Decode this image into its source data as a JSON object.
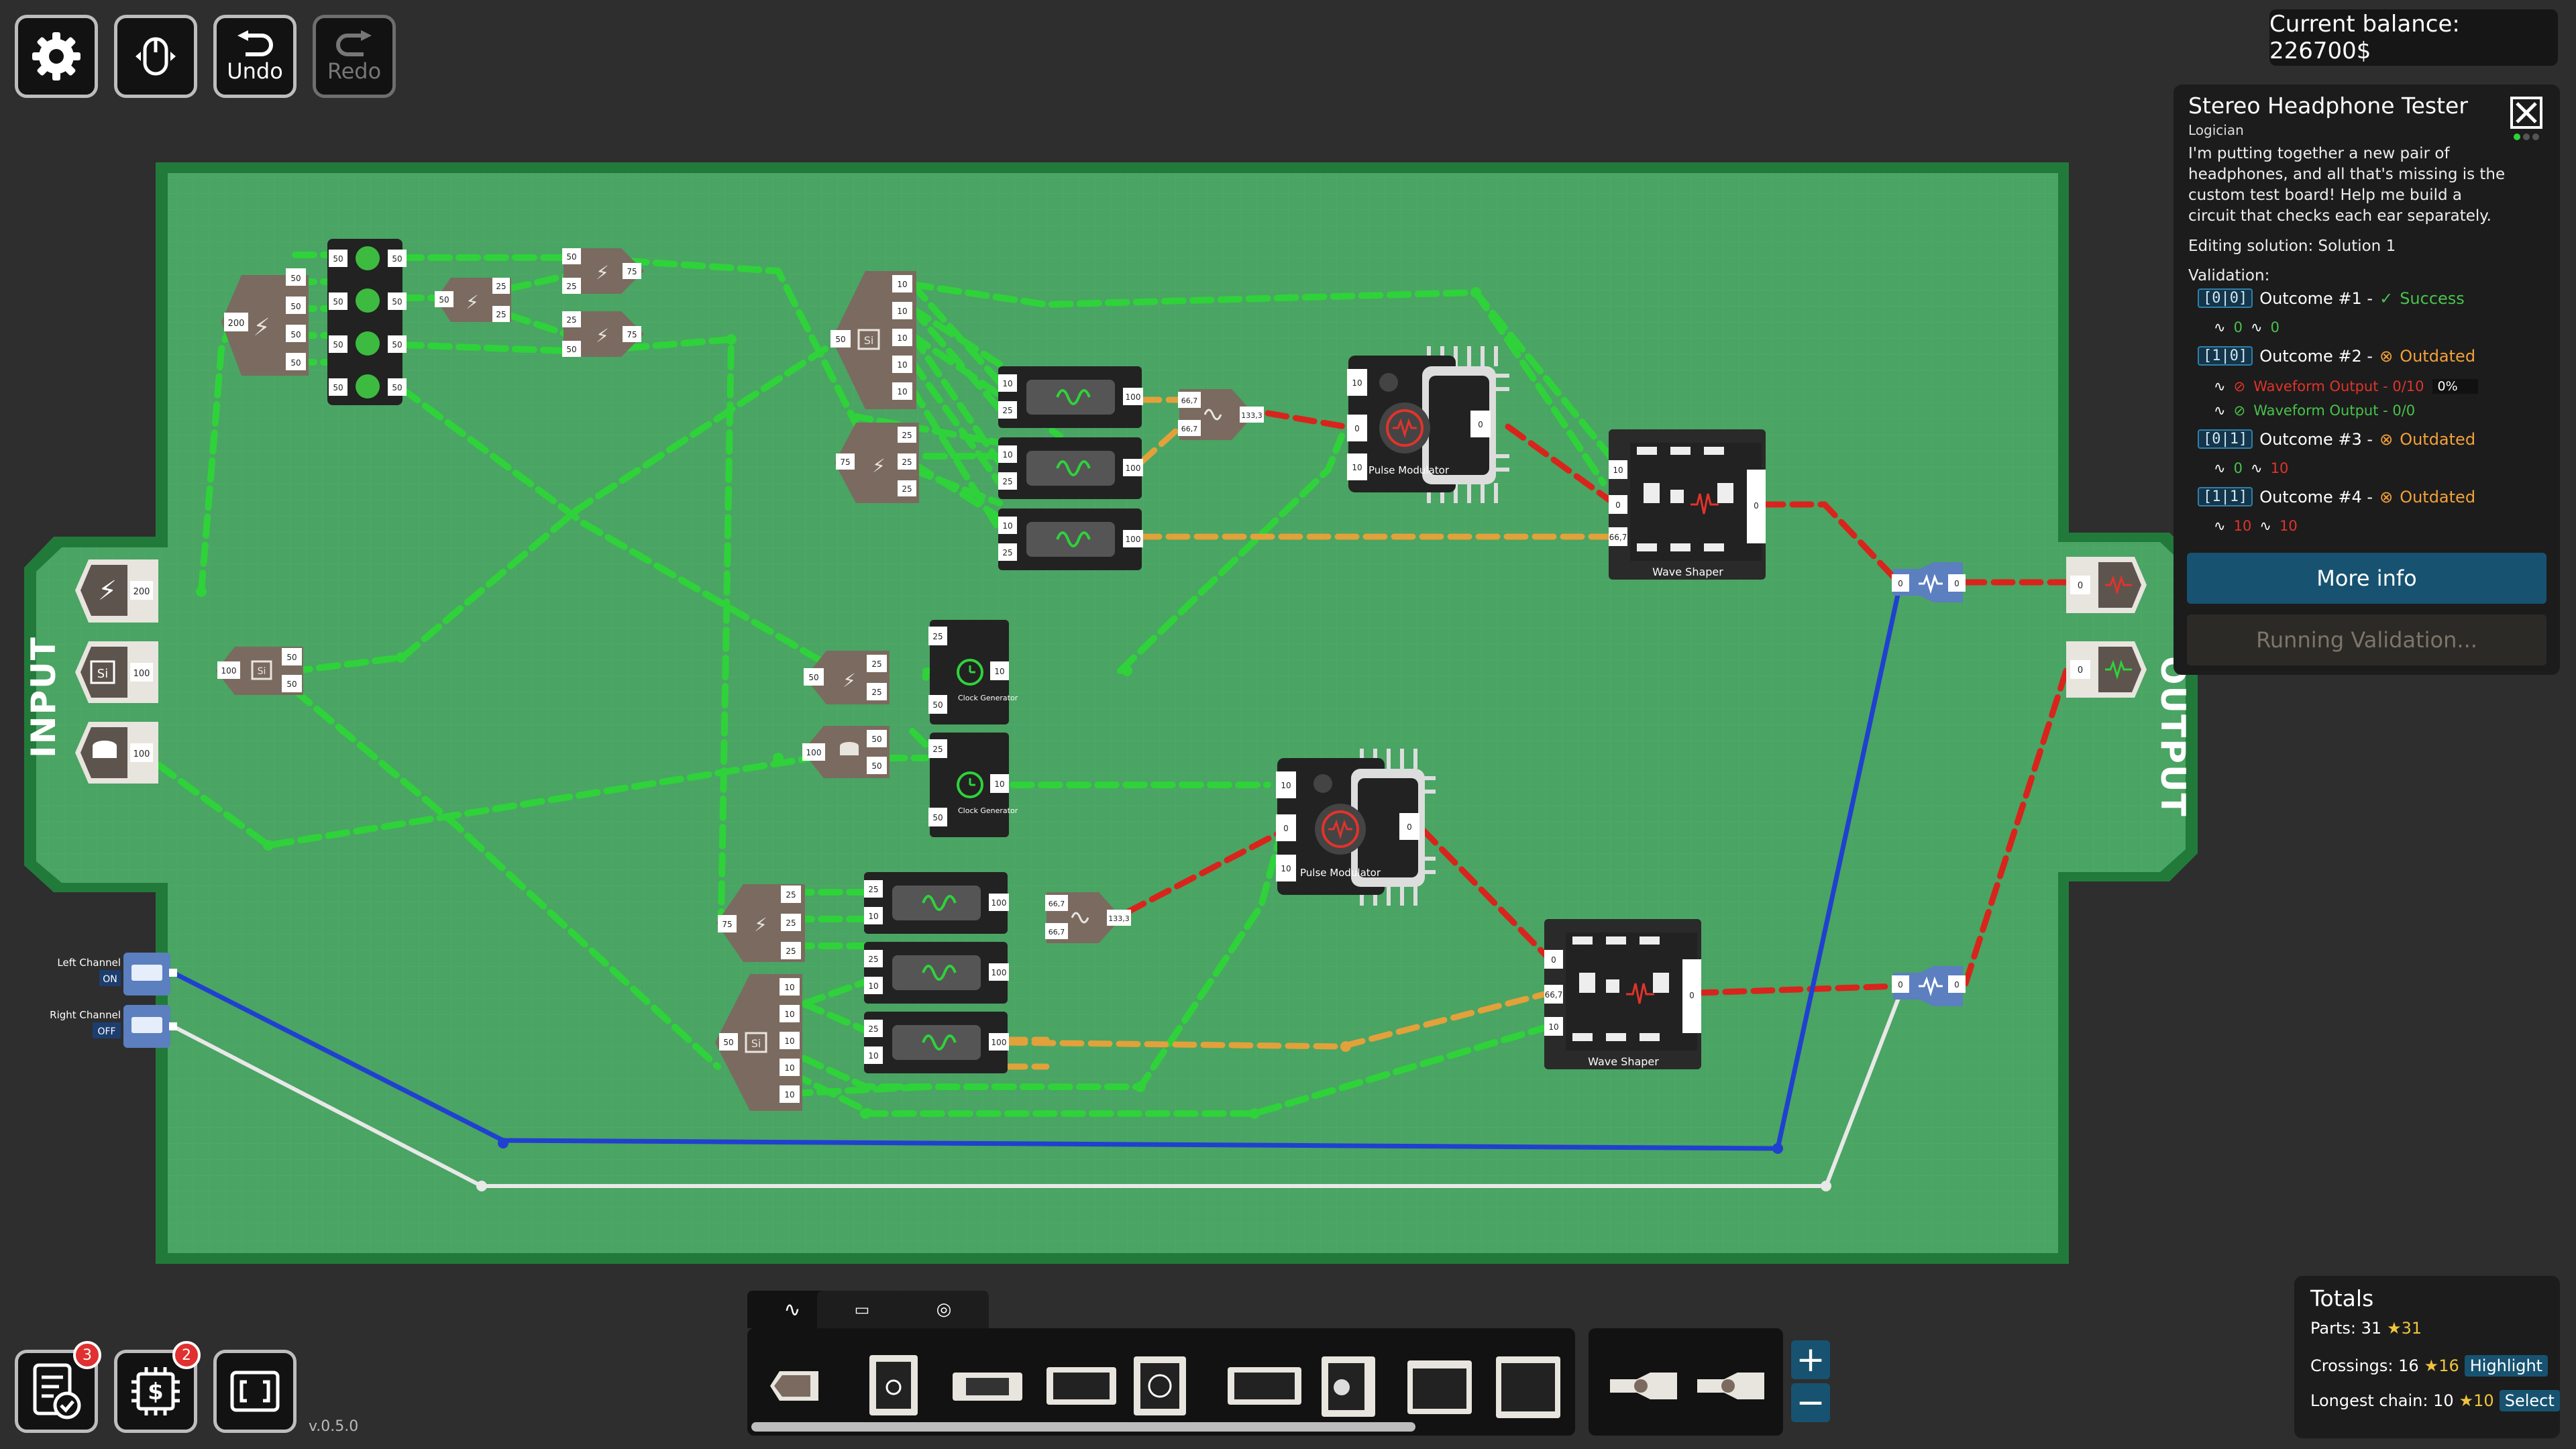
{
  "toolbar": {
    "settings_icon": "gear-icon",
    "mouse_icon": "mouse-icon",
    "undo_label": "Undo",
    "redo_label": "Redo"
  },
  "balance": "Current balance: 226700$",
  "board": {
    "input_label": "INPUT",
    "output_label": "OUTPUT",
    "input_ports": [
      "200",
      "100",
      "100"
    ],
    "channels": [
      {
        "name": "Left Channel",
        "state": "ON"
      },
      {
        "name": "Right Channel",
        "state": "OFF"
      }
    ],
    "component_labels": {
      "pulse_modulator": "Pulse Modulator",
      "wave_shaper": "Wave Shaper",
      "clock_generator": "Clock Generator"
    },
    "port_values": {
      "v200": "200",
      "v100": "100",
      "v75": "75",
      "v50": "50",
      "v25": "25",
      "v10": "10",
      "v66": "66,7",
      "v133": "133,3",
      "v0": "0"
    },
    "colors": {
      "board": "#4aa463",
      "board_border": "#227a3a",
      "wire_green": "#2fd23a",
      "wire_orange": "#e2a13a",
      "wire_red": "#d8241c",
      "wire_blue": "#2040d0",
      "wire_white": "#e8e8e8"
    }
  },
  "panel": {
    "title": "Stereo Headphone Tester",
    "subtitle": "Logician",
    "description": "I'm putting together a new pair of headphones, and all that's missing is the custom test board! Help me build a circuit that checks each ear separately.",
    "editing": "Editing solution: Solution 1",
    "validation_label": "Validation:",
    "outcomes": [
      {
        "code": "[0|0]",
        "label": "Outcome #1 -",
        "status": "Success",
        "a": "0",
        "b": "0"
      },
      {
        "code": "[1|0]",
        "label": "Outcome #2 -",
        "status": "Outdated",
        "err1": "Waveform Output - 0/10",
        "pct": "0%",
        "ok1": "Waveform Output - 0/0"
      },
      {
        "code": "[0|1]",
        "label": "Outcome #3 -",
        "status": "Outdated",
        "a": "0",
        "b": "10"
      },
      {
        "code": "[1|1]",
        "label": "Outcome #4 -",
        "status": "Outdated",
        "a": "10",
        "b": "10"
      }
    ],
    "more_info": "More info",
    "running": "Running Validation..."
  },
  "totals": {
    "title": "Totals",
    "parts": "Parts: 31",
    "parts_star": "★31",
    "crossings": "Crossings: 16",
    "crossings_star": "★16",
    "highlight": "Highlight",
    "chain": "Longest chain: 10",
    "chain_star": "★10",
    "select": "Select"
  },
  "bottom": {
    "badge1": "3",
    "badge2": "2",
    "version": "v.0.5.0"
  }
}
